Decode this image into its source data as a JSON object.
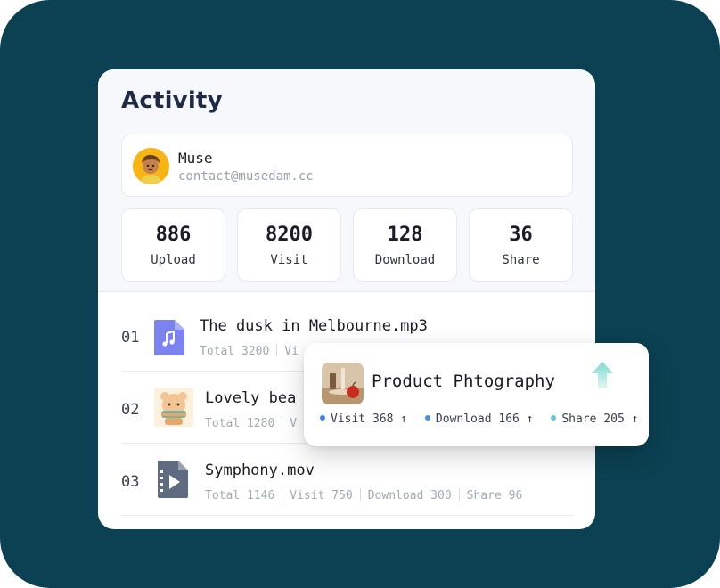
{
  "card": {
    "title": "Activity"
  },
  "profile": {
    "name": "Muse",
    "email": "contact@musedam.cc"
  },
  "stats": [
    {
      "value": "886",
      "label": "Upload"
    },
    {
      "value": "8200",
      "label": "Visit"
    },
    {
      "value": "128",
      "label": "Download"
    },
    {
      "value": "36",
      "label": "Share"
    }
  ],
  "items": [
    {
      "index": "01",
      "title": "The dusk in Melbourne.mp3",
      "icon": "music-file-icon",
      "meta": [
        "Total 3200",
        "Vi"
      ]
    },
    {
      "index": "02",
      "title": "Lovely bea",
      "icon": "image-thumbnail",
      "meta": [
        "Total 1280",
        "V"
      ]
    },
    {
      "index": "03",
      "title": "Symphony.mov",
      "icon": "video-file-icon",
      "meta": [
        "Total 1146",
        "Visit 750",
        "Download 300",
        "Share 96"
      ]
    }
  ],
  "popup": {
    "title": "Product Phtography",
    "stats": [
      {
        "label": "Visit 368 ↑",
        "color": "#3b82f6"
      },
      {
        "label": "Download 166 ↑",
        "color": "#4a90e2"
      },
      {
        "label": "Share 205 ↑",
        "color": "#5cc9d4"
      }
    ]
  },
  "colors": {
    "background": "#0b4152",
    "accent": "#7c83f0"
  }
}
